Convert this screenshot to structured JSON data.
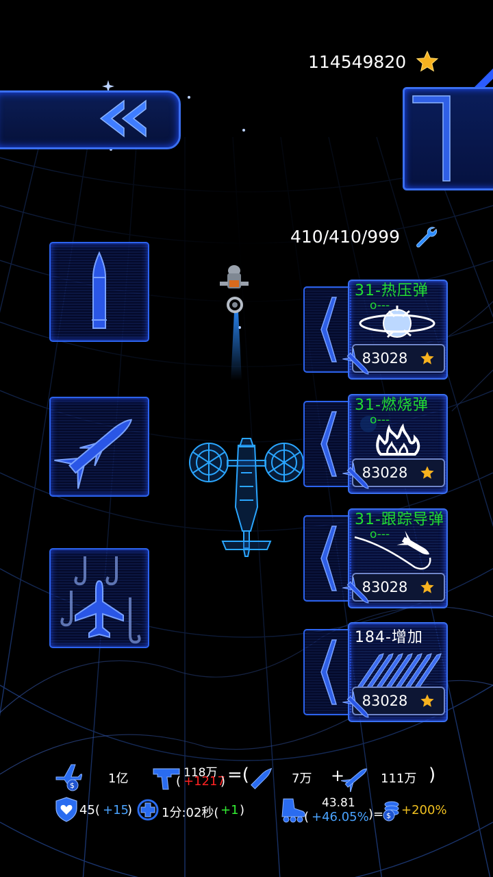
{
  "currency": {
    "amount": "114549820",
    "icon": "star-icon"
  },
  "parts": {
    "count": "410/410/999",
    "icon": "wrench-icon"
  },
  "back_button": {
    "icon": "double-chevron-left-icon"
  },
  "weapon_slots": [
    {
      "icon": "bullet-icon"
    },
    {
      "icon": "missile-icon"
    },
    {
      "icon": "plane-homing-icon"
    }
  ],
  "upgrades": [
    {
      "title": "31-热压弹",
      "level": "o---",
      "price": "83028",
      "icon": "thermobaric-orb-icon"
    },
    {
      "title": "31-燃烧弹",
      "level": "o---",
      "price": "83028",
      "icon": "flame-icon"
    },
    {
      "title": "31-跟踪导弹",
      "level": "o---",
      "price": "83028",
      "icon": "homing-missile-icon"
    },
    {
      "title": "184-增加",
      "level": "",
      "price": "83028",
      "icon": "missile-barrage-icon"
    }
  ],
  "stats": {
    "plane_value": "1亿",
    "gun_top": "118万",
    "gun_paren_open": "(",
    "gun_delta": "+1217",
    "gun_paren_close": ")",
    "equals_open": "=(",
    "bullet_value": "7万",
    "plus": "+",
    "missile_value": "111万",
    "close_paren": ")",
    "shield_value": "45(",
    "shield_delta": "+15",
    "shield_close": ")",
    "heal_value": "1分:02秒(",
    "heal_delta": "+1",
    "heal_close": ")",
    "speed_top": "43.81",
    "speed_paren_open": "(",
    "speed_delta": "+46.05%",
    "speed_close": ")=",
    "bonus": "+200%"
  }
}
